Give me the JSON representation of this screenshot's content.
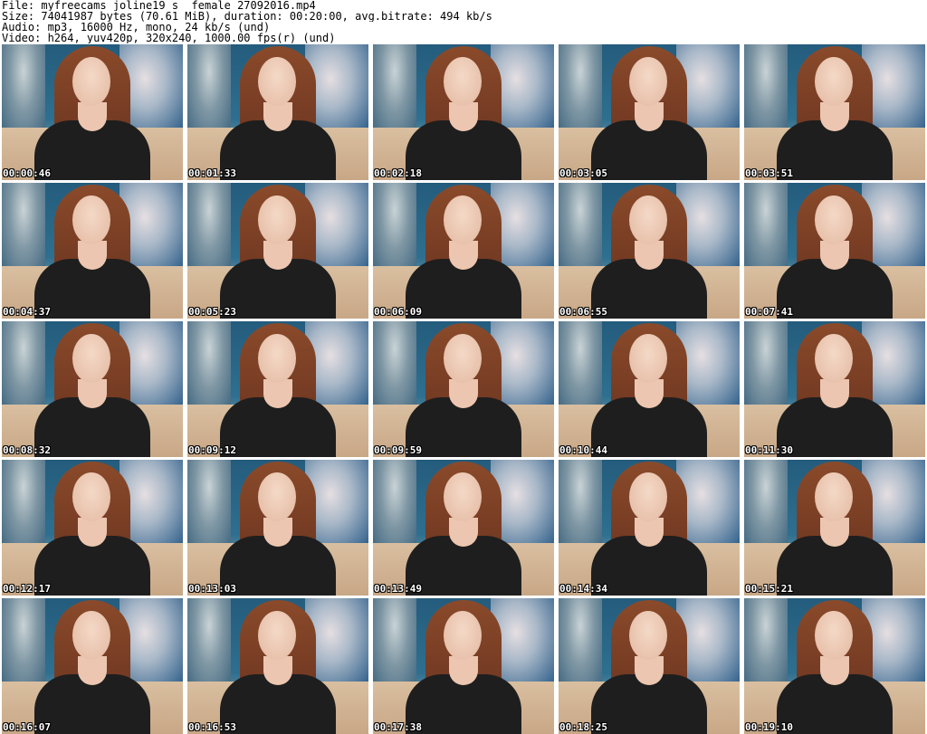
{
  "header": {
    "file_line": "File: myfreecams_joline19_s _female_27092016.mp4",
    "size_line": "Size: 74041987 bytes (70.61 MiB), duration: 00:20:00, avg.bitrate: 494 kb/s",
    "audio_line": "Audio: mp3, 16000 Hz, mono, 24 kb/s (und)",
    "video_line": "Video: h264, yuv420p, 320x240, 1000.00 fps(r) (und)"
  },
  "thumbnails": [
    {
      "timestamp": "00:00:46"
    },
    {
      "timestamp": "00:01:33"
    },
    {
      "timestamp": "00:02:18"
    },
    {
      "timestamp": "00:03:05"
    },
    {
      "timestamp": "00:03:51"
    },
    {
      "timestamp": "00:04:37"
    },
    {
      "timestamp": "00:05:23"
    },
    {
      "timestamp": "00:06:09"
    },
    {
      "timestamp": "00:06:55"
    },
    {
      "timestamp": "00:07:41"
    },
    {
      "timestamp": "00:08:32"
    },
    {
      "timestamp": "00:09:12"
    },
    {
      "timestamp": "00:09:59"
    },
    {
      "timestamp": "00:10:44"
    },
    {
      "timestamp": "00:11:30"
    },
    {
      "timestamp": "00:12:17"
    },
    {
      "timestamp": "00:13:03"
    },
    {
      "timestamp": "00:13:49"
    },
    {
      "timestamp": "00:14:34"
    },
    {
      "timestamp": "00:15:21"
    },
    {
      "timestamp": "00:16:07"
    },
    {
      "timestamp": "00:16:53"
    },
    {
      "timestamp": "00:17:38"
    },
    {
      "timestamp": "00:18:25"
    },
    {
      "timestamp": "00:19:10"
    }
  ]
}
